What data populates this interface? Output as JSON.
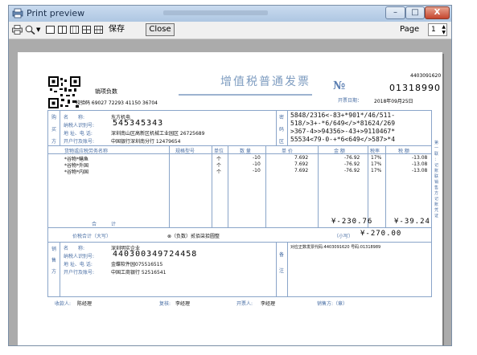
{
  "window": {
    "title": "Print preview",
    "btn_min": "–",
    "btn_max": "□",
    "btn_close": "X"
  },
  "toolbar": {
    "save_label": "保存",
    "close_label": "Close",
    "page_label": "Page",
    "page_value": "1"
  },
  "invoice": {
    "title": "增值税普通发票",
    "seller_code_label": "销项负数",
    "check_code": "校验码 69027 72293 41150 36704",
    "no_label": "№",
    "code_right_1": "4403091620",
    "code_right_2": "01318990",
    "date_label": "开票日期：",
    "date_value": "2018年09月25日",
    "buyer": {
      "side_label": [
        "购",
        "买",
        "方"
      ],
      "name_label": "名　　称:",
      "name_value": "东方机电",
      "taxid_label": "纳税人识别号:",
      "taxid_value": "545345343",
      "addr_label": "地 址、电 话:",
      "addr_value": "深圳南山区高新区机械工业园区 26725689",
      "bank_label": "开户行及账号:",
      "bank_value": "中国银行深圳南分行 12479654"
    },
    "password_side": [
      "密",
      "码",
      "区"
    ],
    "password_lines": [
      "5848/2316<-83+*901*/46/511-",
      "518/>3+-*6/649</>*81624/269",
      ">367-4>>94356>-43+>9110467*",
      "55534<79-0-+*6<649</>587>*4"
    ],
    "columns": {
      "goods": "货物或应税劳务名称",
      "spec": "规格型号",
      "unit": "单位",
      "qty": "数 量",
      "price": "单 价",
      "amount": "金 额",
      "rate": "税率",
      "tax": "税 额"
    },
    "items": [
      {
        "name": "*谷物*鳝鱼",
        "unit": "个",
        "qty": "-10",
        "price": "7.692",
        "amount": "-76.92",
        "rate": "17%",
        "tax": "-13.08"
      },
      {
        "name": "*谷物*外国",
        "unit": "个",
        "qty": "-10",
        "price": "7.692",
        "amount": "-76.92",
        "rate": "17%",
        "tax": "-13.08"
      },
      {
        "name": "*谷物*内国",
        "unit": "个",
        "qty": "-10",
        "price": "7.692",
        "amount": "-76.92",
        "rate": "17%",
        "tax": "-13.08"
      }
    ],
    "subtotal_label": "合　　　计",
    "subtotal_amount": "¥-230.76",
    "subtotal_tax": "¥-39.24",
    "total_label": "价税合计（大写）",
    "total_words": "⊗（负数）贰佰柒拾圆整",
    "total_small_label": "（小写）",
    "total_small_value": "¥-270.00",
    "seller": {
      "side_label": [
        "销",
        "售",
        "方"
      ],
      "name_label": "名　　称:",
      "name_value": "深圳明实企业",
      "taxid_label": "纳税人识别号:",
      "taxid_value": "440300349724458",
      "addr_label": "地 址、电 话:",
      "addr_value": "金蝶软件园075516515",
      "bank_label": "开户行及账号:",
      "bank_value": "中国工商银行 52516541"
    },
    "remark_side": [
      "备",
      "注"
    ],
    "remark_value": "对应正数发票代码:4403091620  号码:01318989",
    "side_note": [
      "第",
      "一",
      "联",
      "：",
      "记",
      "账",
      "联",
      "销",
      "售",
      "方",
      "记",
      "账",
      "凭",
      "证"
    ],
    "footer": {
      "payee_label": "收款人:",
      "payee_value": "陈经理",
      "reviewer_label": "复核:",
      "reviewer_value": "李经理",
      "drawer_label": "开票人:",
      "drawer_value": "李经理",
      "seller_label": "销售方:（章）"
    }
  }
}
